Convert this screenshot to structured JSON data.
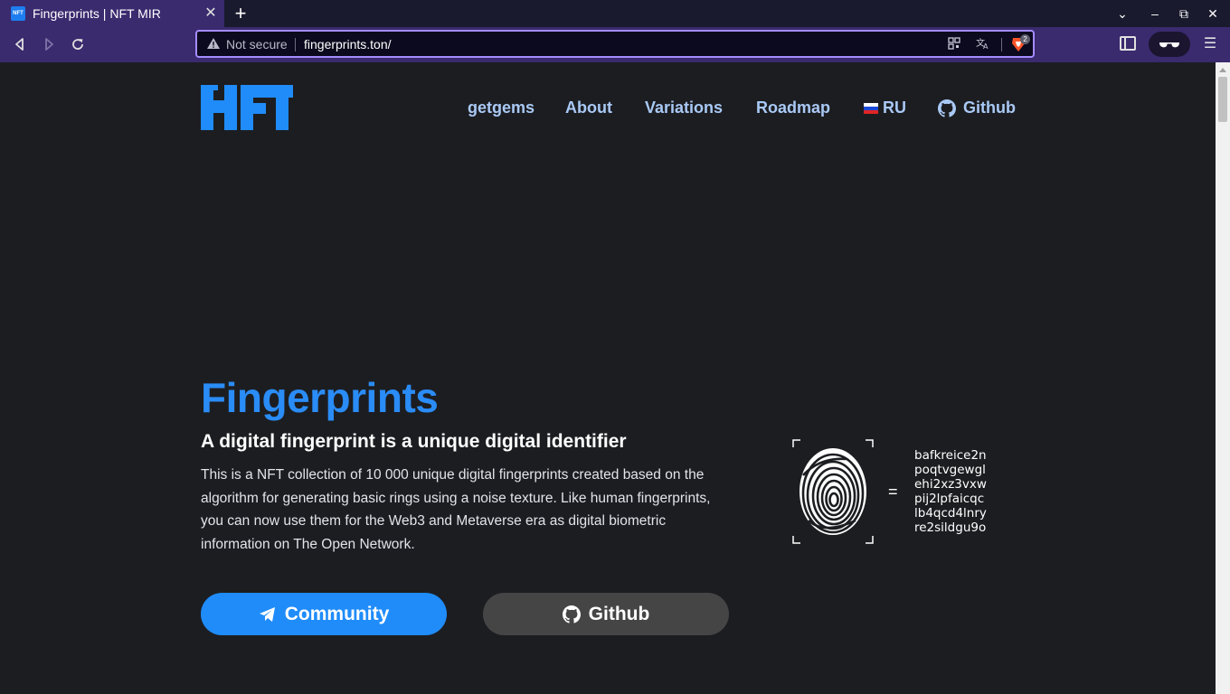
{
  "browser": {
    "tab_title": "Fingerprints | NFT MIR",
    "favicon_text": "NFT",
    "tab_close": "✕",
    "new_tab": "+",
    "security_label": "Not secure",
    "url": "fingerprints.ton/",
    "shield_badge": "2",
    "win_minimize": "–",
    "win_restore": "⧉",
    "win_close": "✕",
    "tab_dropdown": "⌄",
    "menu": "☰"
  },
  "nav": {
    "items": [
      {
        "label": "getgems"
      },
      {
        "label": "About"
      },
      {
        "label": "Variations"
      },
      {
        "label": "Roadmap"
      },
      {
        "label": "RU"
      },
      {
        "label": "Github"
      }
    ]
  },
  "hero": {
    "title": "Fingerprints",
    "subtitle": "A digital fingerprint is a unique digital identifier",
    "description": "This is a NFT collection of 10 000 unique digital fingerprints created based on the algorithm for generating basic rings using a noise texture. Like human fingerprints, you can now use them for the Web3 and Metaverse era as digital biometric information on The Open Network.",
    "buttons": {
      "community": "Community",
      "github": "Github"
    }
  },
  "fingerprint": {
    "equals": "=",
    "hash_lines": [
      "bafkreice2n",
      "poqtvgewgl",
      "ehi2xz3vxw",
      "pij2lpfaicqc",
      "lb4qcd4lnry",
      "re2sildgu9o"
    ]
  },
  "colors": {
    "accent": "#1f8cfa",
    "title": "#2a8cf6",
    "nav_text": "#a9c9f5",
    "page_bg": "#1c1d21",
    "chrome_bg": "#3a2a6e",
    "github_button": "#454545"
  }
}
